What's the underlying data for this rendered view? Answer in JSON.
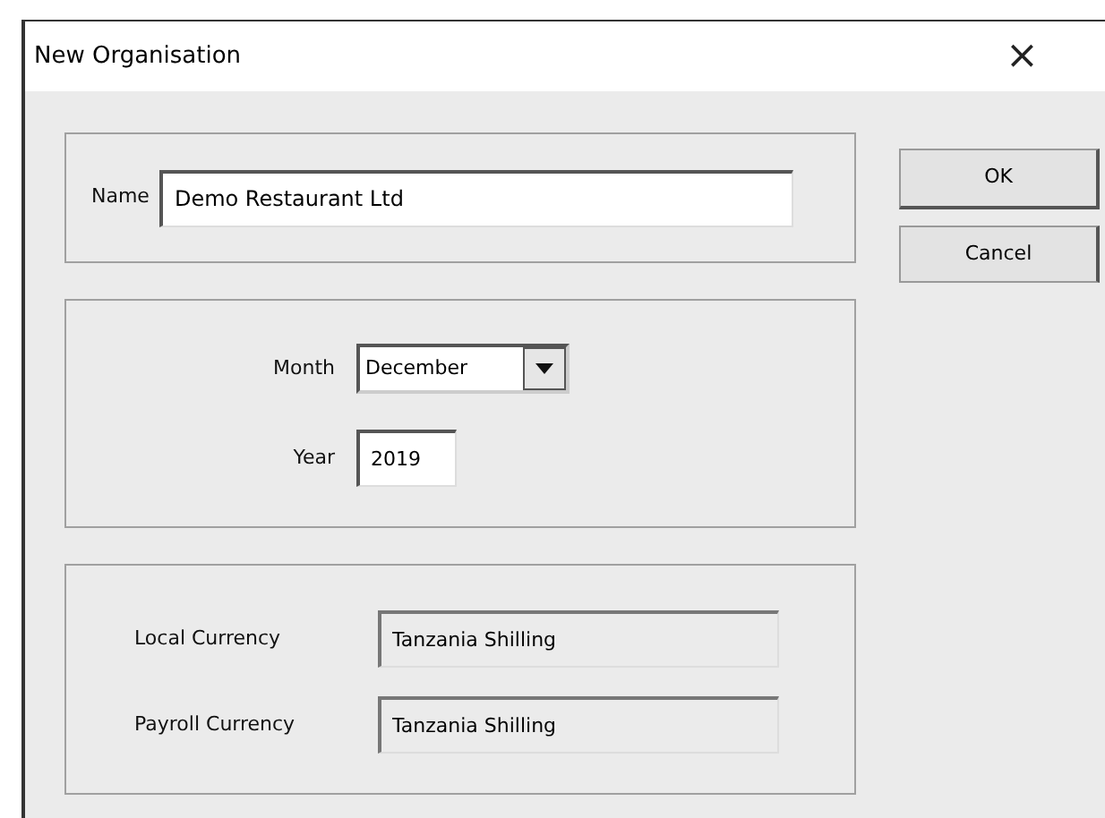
{
  "window": {
    "title": "New Organisation",
    "close": "×"
  },
  "name_group": {
    "label": "Name",
    "value": "Demo Restaurant Ltd"
  },
  "buttons": [
    {
      "label": "OK",
      "kind": "default"
    },
    {
      "label": "Cancel",
      "kind": "normal"
    }
  ],
  "period_group": {
    "month": {
      "label": "Month",
      "value": "December"
    },
    "year": {
      "label": "Year",
      "value": "2019"
    }
  },
  "currency_group": [
    {
      "label": "Local Currency",
      "value": "Tanzania Shilling",
      "read_only": true
    },
    {
      "label": "Payroll Currency",
      "value": "Tanzania Shilling",
      "read_only": true
    }
  ]
}
